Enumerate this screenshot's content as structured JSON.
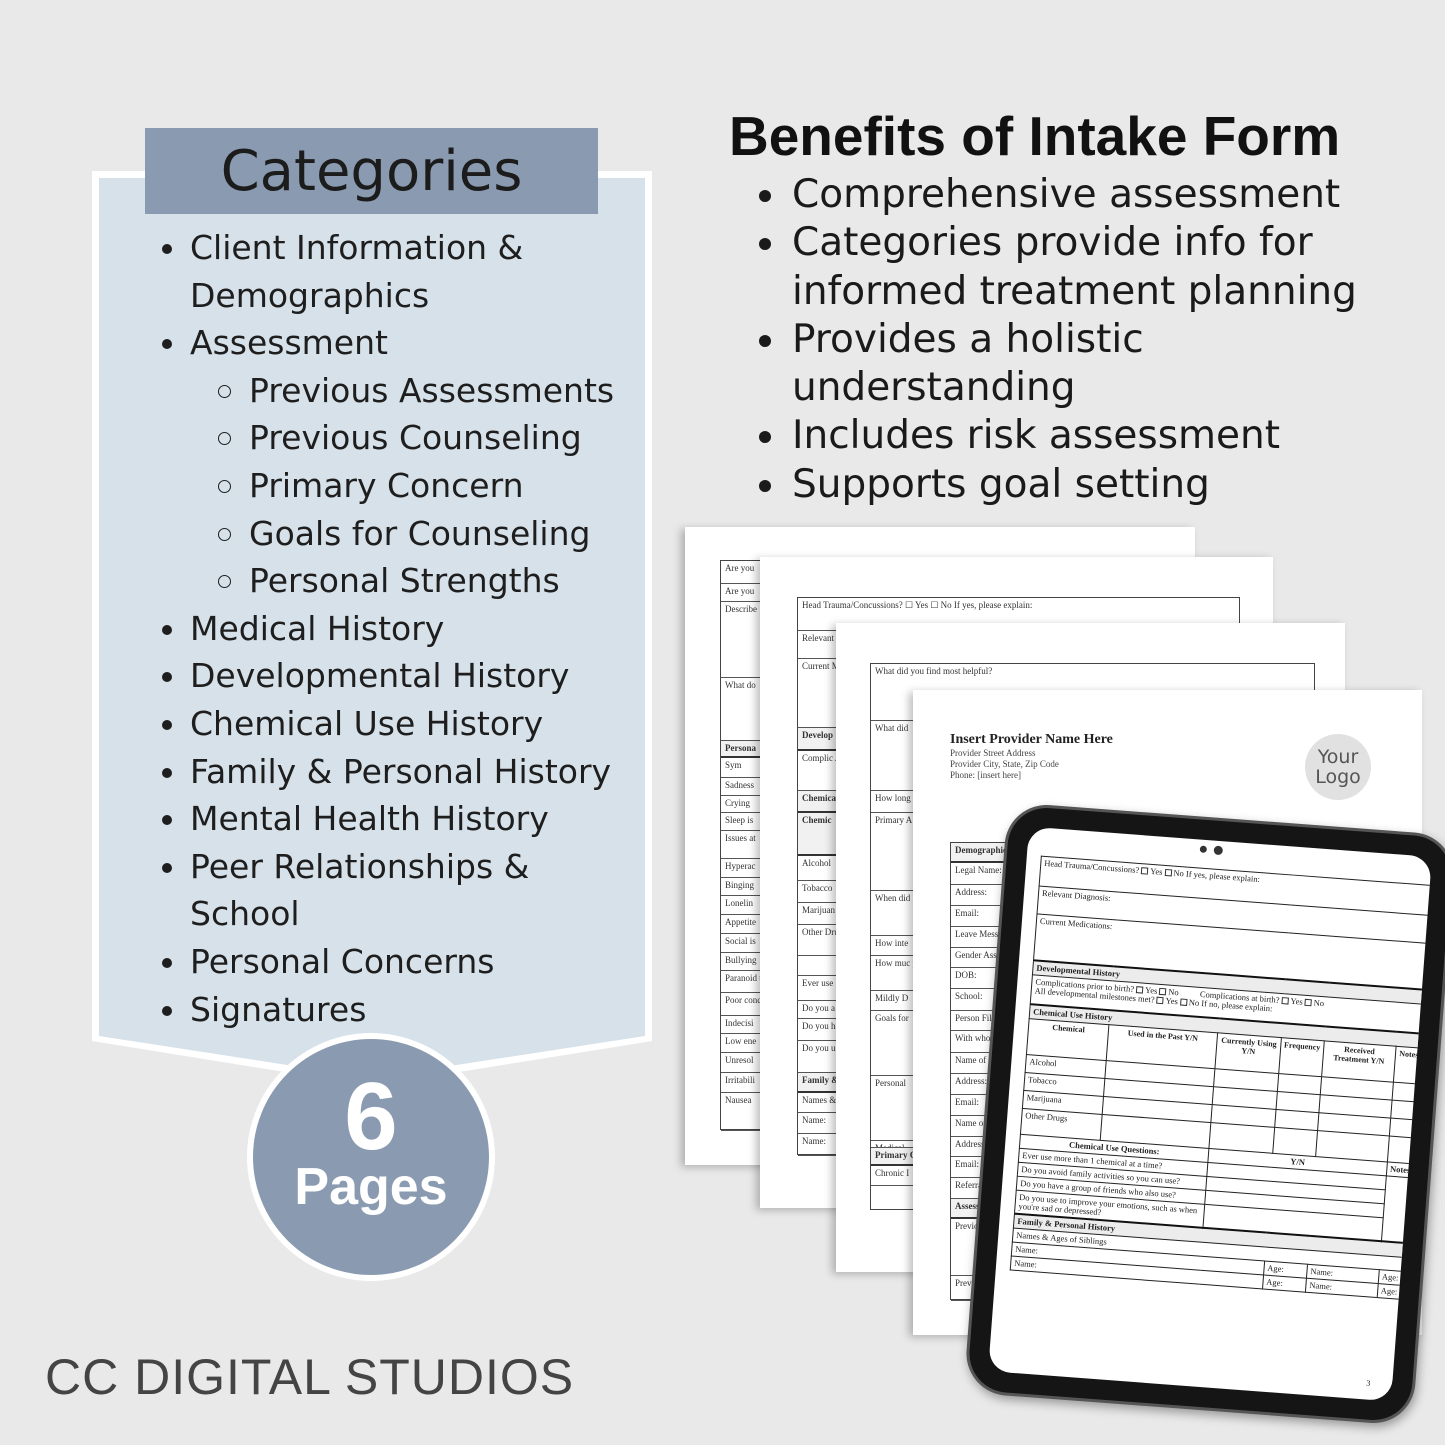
{
  "categories": {
    "title": "Categories",
    "items": [
      {
        "label": "Client Information & Demographics",
        "level": 1
      },
      {
        "label": "Assessment",
        "level": 1
      },
      {
        "label": "Previous Assessments",
        "level": 2
      },
      {
        "label": "Previous Counseling",
        "level": 2
      },
      {
        "label": "Primary Concern",
        "level": 2
      },
      {
        "label": "Goals for Counseling",
        "level": 2
      },
      {
        "label": "Personal Strengths",
        "level": 2
      },
      {
        "label": "Medical History",
        "level": 1
      },
      {
        "label": "Developmental History",
        "level": 1
      },
      {
        "label": "Chemical Use History",
        "level": 1
      },
      {
        "label": "Family & Personal History",
        "level": 1
      },
      {
        "label": "Mental Health History",
        "level": 1
      },
      {
        "label": "Peer Relationships & School",
        "level": 1
      },
      {
        "label": "Personal Concerns",
        "level": 1
      },
      {
        "label": "Signatures",
        "level": 1
      }
    ]
  },
  "badge": {
    "number": "6",
    "label": "Pages",
    "color": "#8a9bb1"
  },
  "brand": "CC DIGITAL STUDIOS",
  "benefits": {
    "title": "Benefits of Intake Form",
    "items": [
      "Comprehensive assessment",
      "Categories provide info for informed treatment planning",
      "Provides a holistic understanding",
      "Includes risk assessment",
      "Supports goal setting"
    ]
  },
  "pages": [
    {
      "rows": [
        "Are you",
        "Are you",
        "Describe",
        "What do",
        "Persona",
        "Sym",
        "Sadness",
        "Crying",
        "Sleep is",
        "Issues at",
        "Hyperac",
        "Binging",
        "Lonelin",
        "Appetite",
        "Social is",
        "Bullying",
        "Paranoid thoughts",
        "Poor concentr",
        "Indecisi",
        "Low ene",
        "Unresol",
        "Irritabili",
        "Nausea"
      ]
    },
    {
      "rows": [
        "Head Trauma/Concussions? ☐ Yes ☐ No  If yes, please explain:",
        "Relevant",
        "Current M",
        "Develop",
        "Complic All devel",
        "Chemica",
        "Chemic",
        "Alcohol",
        "Tobacco",
        "Marijuan",
        "Other Drugs",
        "",
        "Ever use",
        "Do you a",
        "Do you h",
        "Do you u as when",
        "Family &",
        "Names &",
        "Name:",
        "Name:"
      ]
    },
    {
      "rows": [
        "What did you find most helpful?",
        "What did",
        "How long",
        "Primary A",
        "When did",
        "How inte",
        "How muc perform",
        "Mildly D",
        "Goals for",
        "Personal",
        "Medical",
        "Primary C",
        "Chronic I"
      ]
    },
    {
      "provider": {
        "name": "Insert Provider Name Here",
        "street": "Provider Street Address",
        "city": "Provider City, State, Zip Code",
        "phone": "Phone: [insert here]"
      },
      "logo": "Your Logo",
      "rows": [
        "Demographics",
        "Legal Name:",
        "Address:",
        "Email:",
        "Leave Message",
        "Gender Assign",
        "DOB:",
        "School:",
        "Person Filling",
        "With whom",
        "Name of Pa",
        "Address:",
        "Email:",
        "Name of",
        "Address:",
        "Email:",
        "Referral",
        "Assess",
        "Previo",
        "Prev"
      ]
    }
  ],
  "tablet": {
    "head_trauma": "Head Trauma/Concussions?",
    "yes": "Yes",
    "no": "No",
    "if_yes": "If yes, please explain:",
    "relevant_diagnosis": "Relevant Diagnosis:",
    "current_medications": "Current Medications:",
    "developmental_history": "Developmental History",
    "complications_prior": "Complications prior to birth?",
    "complications_at": "Complications at birth?",
    "milestones": "All developmental milestones met?",
    "if_no": "If no, please explain:",
    "chemical_use_history": "Chemical Use History",
    "columns": [
      "Chemical",
      "Used in the Past Y/N",
      "Currently Using Y/N",
      "Frequency",
      "Received Treatment Y/N",
      "Notes"
    ],
    "chemicals": [
      "Alcohol",
      "Tobacco",
      "Marijuana",
      "Other Drugs"
    ],
    "questions_title": "Chemical Use Questions:",
    "yn": "Y/N",
    "notes": "Notes",
    "questions": [
      "Ever use more than 1 chemical at a time?",
      "Do you avoid family activities so you can use?",
      "Do you have a group of friends who also use?",
      "Do you use to improve your emotions, such as when you're sad or depressed?"
    ],
    "family_history": "Family & Personal History",
    "siblings": "Names & Ages of Siblings",
    "name": "Name:",
    "age": "Age:",
    "page_number": "3"
  }
}
